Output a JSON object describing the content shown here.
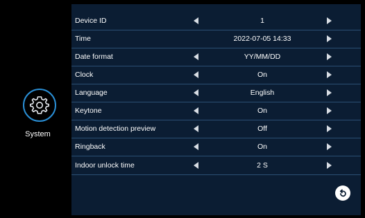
{
  "sidebar": {
    "icon": "gear-icon",
    "label": "System"
  },
  "settings": [
    {
      "label": "Device ID",
      "value": "1"
    },
    {
      "label": "Time",
      "value": "2022-07-05  14:33"
    },
    {
      "label": "Date format",
      "value": "YY/MM/DD"
    },
    {
      "label": "Clock",
      "value": "On"
    },
    {
      "label": "Language",
      "value": "English"
    },
    {
      "label": "Keytone",
      "value": "On"
    },
    {
      "label": "Motion detection preview",
      "value": "Off"
    },
    {
      "label": "Ringback",
      "value": "On"
    },
    {
      "label": "Indoor unlock time",
      "value": "2 S"
    }
  ],
  "controls": {
    "back_icon": "back-icon"
  },
  "colors": {
    "background": "#0b1d33",
    "accent": "#2a8fd6",
    "divider": "#2b4f74"
  }
}
